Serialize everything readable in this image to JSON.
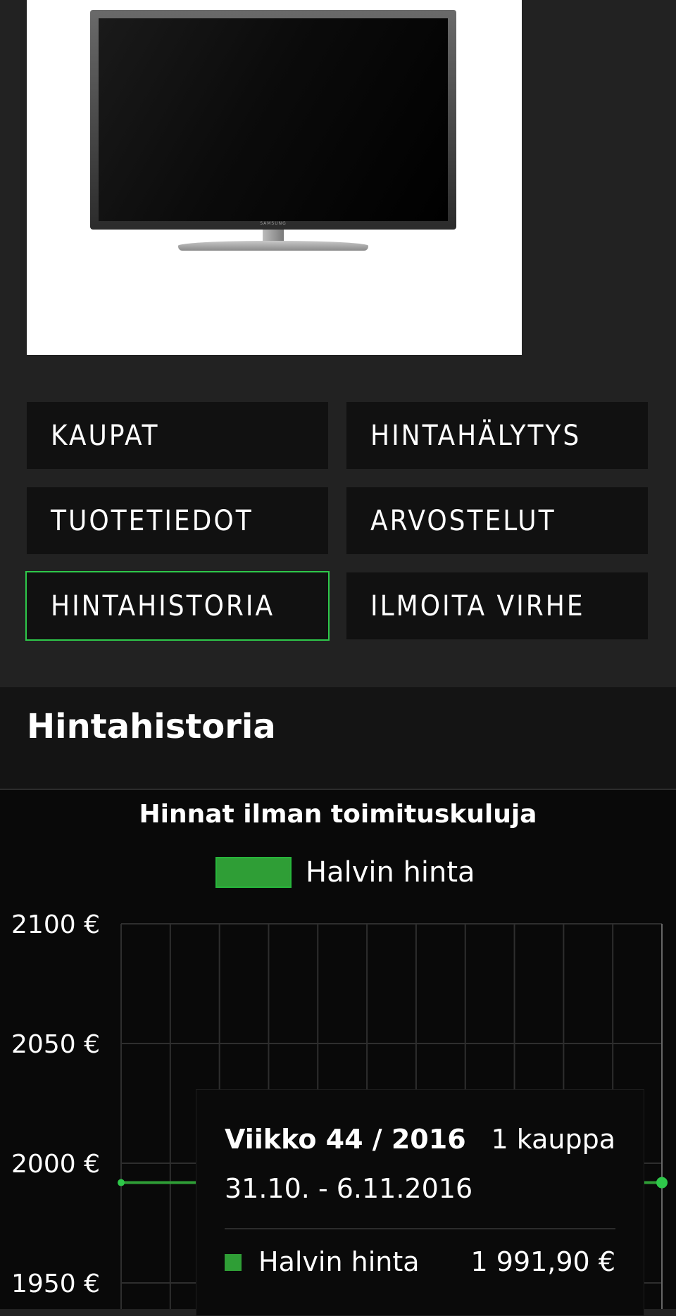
{
  "product": {
    "image_alt": "Samsung LCD TV",
    "tv_logo_text": "SAMSUNG"
  },
  "nav": {
    "kaupat": "KAUPAT",
    "hintahalytys": "HINTAHÄLYTYS",
    "tuotetiedot": "TUOTETIEDOT",
    "arvostelut": "ARVOSTELUT",
    "hintahistoria": "HINTAHISTORIA",
    "ilmoita_virhe": "ILMOITA VIRHE"
  },
  "section": {
    "title": "Hintahistoria"
  },
  "chart_data": {
    "type": "line",
    "title": "Hinnat ilman toimituskuluja",
    "series": [
      {
        "name": "Halvin hinta",
        "values": [
          1991.9,
          1991.9
        ],
        "color": "#2ec84a"
      }
    ],
    "y_tick_labels": [
      "2100 €",
      "2050 €",
      "2000 €",
      "1950 €"
    ],
    "y_ticks": [
      2100,
      2050,
      2000,
      1950
    ],
    "legend": "top-center",
    "grid": true
  },
  "tooltip": {
    "week": "Viikko 44 / 2016",
    "count": "1 kauppa",
    "dates": "31.10. - 6.11.2016",
    "series_label": "Halvin hinta",
    "value": "1 991,90 €"
  },
  "colors": {
    "accent": "#2ec84a",
    "line": "#2f9e36"
  }
}
